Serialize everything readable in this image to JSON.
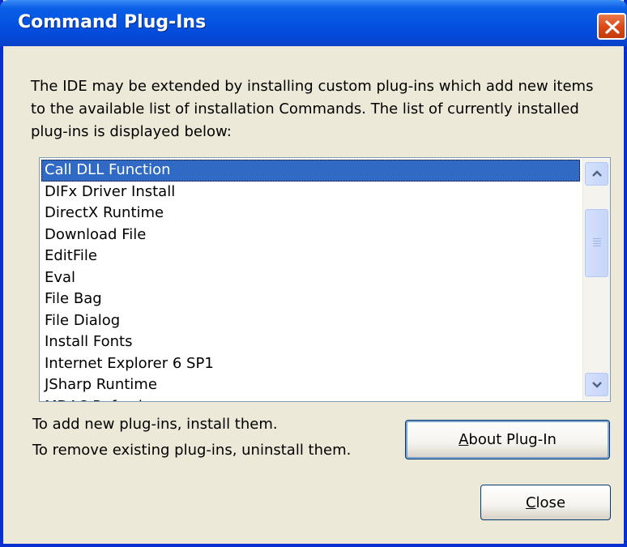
{
  "window": {
    "title": "Command Plug-Ins"
  },
  "description": "The IDE may be extended by installing custom plug-ins which add new items to the available list of installation Commands. The list of currently installed plug-ins is displayed below:",
  "plugins": {
    "selected_index": 0,
    "items": [
      "Call DLL Function",
      "DIFx Driver Install",
      "DirectX Runtime",
      "Download File",
      "EditFile",
      "Eval",
      "File Bag",
      "File Dialog",
      "Install Fonts",
      "Internet Explorer 6 SP1",
      "JSharp Runtime",
      "MDAC Refresh"
    ]
  },
  "hints": {
    "add": "To add new plug-ins, install them.",
    "remove": "To remove existing plug-ins, uninstall them."
  },
  "buttons": {
    "about_accel": "A",
    "about_rest": "bout Plug-In",
    "close_accel": "C",
    "close_rest": "lose"
  },
  "colors": {
    "titlebar": "#0553e1",
    "selection": "#316ac5",
    "close_button": "#dc4a18",
    "dialog_bg": "#ece9d8"
  },
  "icons": {
    "close": "close-x-icon",
    "scroll_up": "scroll-up-arrow-icon",
    "scroll_down": "scroll-down-arrow-icon"
  }
}
